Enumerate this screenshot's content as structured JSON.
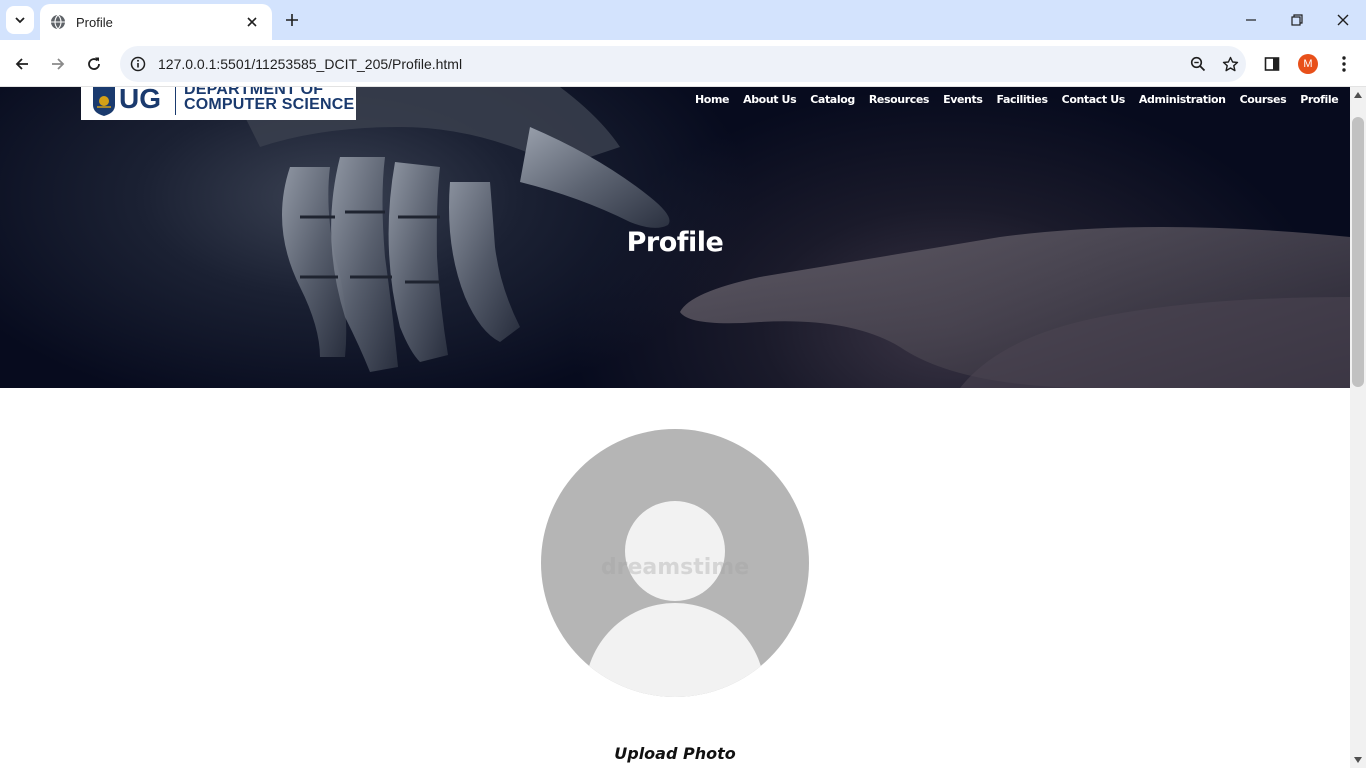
{
  "browser": {
    "tab_title": "Profile",
    "url": "127.0.0.1:5501/11253585_DCIT_205/Profile.html",
    "profile_initial": "M",
    "profile_color": "#e8501a"
  },
  "site": {
    "logo": {
      "short": "UG",
      "line1": "DEPARTMENT OF",
      "line2": "COMPUTER SCIENCE"
    },
    "nav": [
      "Home",
      "About Us",
      "Catalog",
      "Resources",
      "Events",
      "Facilities",
      "Contact Us",
      "Administration",
      "Courses",
      "Profile"
    ]
  },
  "hero": {
    "title": "Profile"
  },
  "profile": {
    "watermark": "dreamstime",
    "upload_label": "Upload Photo"
  }
}
